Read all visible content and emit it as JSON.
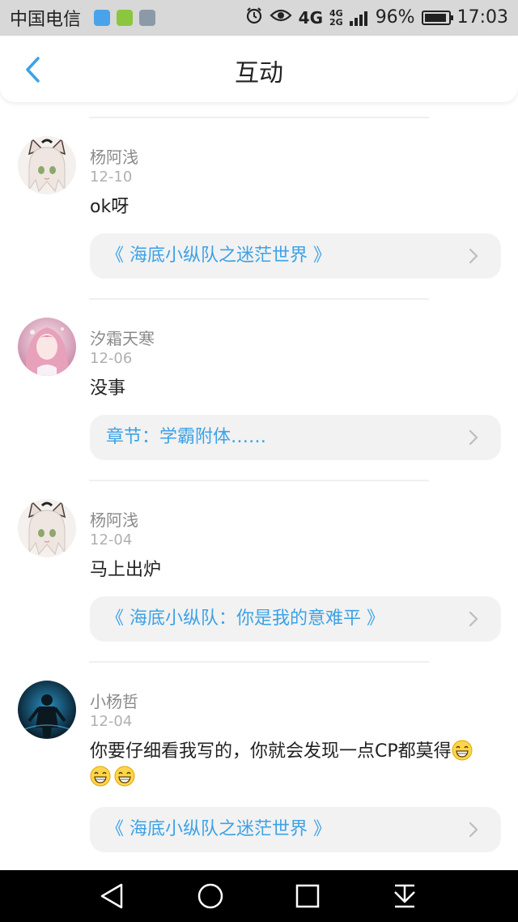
{
  "status_bar": {
    "carrier": "中国电信",
    "app_icons": [
      "app-icon-blue",
      "app-icon-green",
      "app-icon-gray"
    ],
    "alarm_icon": "alarm-icon",
    "eye_icon": "eye-icon",
    "network_main": "4G",
    "network_top": "4G",
    "network_bottom": "2G",
    "battery_percent": "96%",
    "battery_level": 0.96,
    "time": "17:03"
  },
  "header": {
    "title": "互动",
    "back_icon": "back-chevron-icon"
  },
  "colors": {
    "accent": "#3ca2e6",
    "username": "#8a8a8a",
    "date": "#b0b0b0",
    "card_bg": "#f2f2f2",
    "status_bar_bg": "#d8d8d8",
    "nav_bar_bg": "#000000"
  },
  "comments": [
    {
      "username": "杨阿浅",
      "date": "12-10",
      "content": "ok呀",
      "link": "《 海底小纵队之迷茫世界 》"
    },
    {
      "username": "汐霜天寒",
      "date": "12-06",
      "content": "没事",
      "link": "章节：学霸附体……"
    },
    {
      "username": "杨阿浅",
      "date": "12-04",
      "content": "马上出炉",
      "link": "《 海底小纵队：你是我的意难平 》"
    },
    {
      "username": "小杨哲",
      "date": "12-04",
      "content": "你要仔细看我写的，你就会发现一点CP都莫得",
      "emoji_count": 3,
      "emoji_icon": "grinning-emoji-icon",
      "link": "《 海底小纵队之迷茫世界 》"
    }
  ],
  "nav_bar": {
    "icons": [
      "back-triangle-icon",
      "home-circle-icon",
      "recents-square-icon",
      "notification-pulldown-icon"
    ]
  }
}
